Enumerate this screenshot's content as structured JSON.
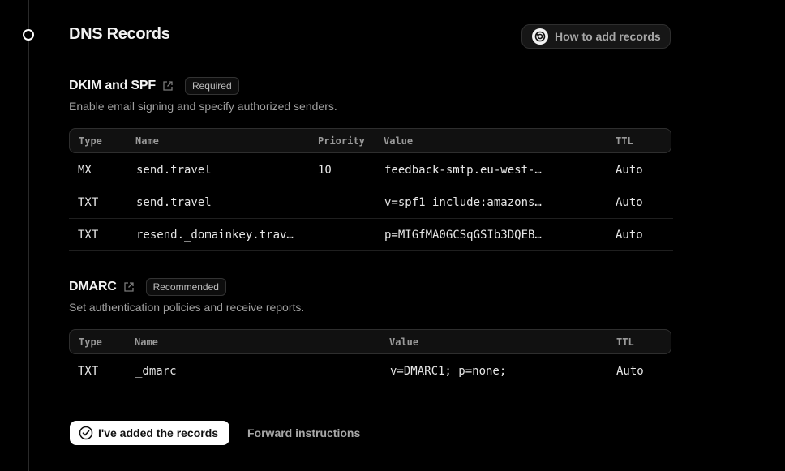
{
  "page": {
    "title": "DNS Records",
    "how_to_button": "How to add records"
  },
  "dkim_spf": {
    "title": "DKIM and SPF",
    "badge": "Required",
    "description": "Enable email signing and specify authorized senders.",
    "headers": {
      "type": "Type",
      "name": "Name",
      "priority": "Priority",
      "value": "Value",
      "ttl": "TTL"
    },
    "rows": [
      {
        "type": "MX",
        "name": "send.travel",
        "priority": "10",
        "value": "feedback-smtp.eu-west-…",
        "ttl": "Auto"
      },
      {
        "type": "TXT",
        "name": "send.travel",
        "priority": "",
        "value": "v=spf1 include:amazons…",
        "ttl": "Auto"
      },
      {
        "type": "TXT",
        "name": "resend._domainkey.trav…",
        "priority": "",
        "value": "p=MIGfMA0GCSqGSIb3DQEB…",
        "ttl": "Auto"
      }
    ]
  },
  "dmarc": {
    "title": "DMARC",
    "badge": "Recommended",
    "description": "Set authentication policies and receive reports.",
    "headers": {
      "type": "Type",
      "name": "Name",
      "value": "Value",
      "ttl": "TTL"
    },
    "rows": [
      {
        "type": "TXT",
        "name": "_dmarc",
        "value": "v=DMARC1; p=none;",
        "ttl": "Auto"
      }
    ]
  },
  "actions": {
    "confirm_label": "I've added the records",
    "forward_label": "Forward instructions"
  },
  "colors": {
    "background": "#000000",
    "text": "#ededed",
    "muted": "#a0a0a0",
    "border": "#2e2e2e",
    "primary_button_bg": "#ffffff"
  },
  "icons": {
    "timeline": "timeline-step-icon",
    "how_to": "guide-icon",
    "external": "external-link-icon",
    "confirm": "check-circle-icon"
  }
}
